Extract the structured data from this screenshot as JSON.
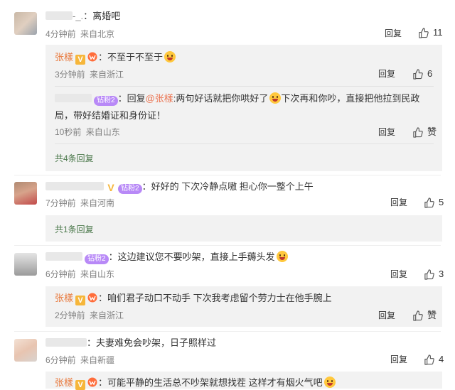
{
  "comments": [
    {
      "user": "-_.",
      "text": "离婚吧",
      "time": "4分钟前",
      "location": "来自北京",
      "reply_label": "回复",
      "likes": "11",
      "replies": [
        {
          "user": "张樣",
          "text": "不至于不至于",
          "time": "3分钟前",
          "location": "来自浙江",
          "reply_label": "回复",
          "likes": "6"
        },
        {
          "badge": "钻粉2",
          "prefix": "回复",
          "mention": "@张樣",
          "text": ":两句好话就把你哄好了",
          "text2": "下次再和你吵，直接把他拉到民政",
          "text3": "局，带好结婚证和身份证！",
          "time": "10秒前",
          "location": "来自山东",
          "reply_label": "回复",
          "likes": "赞"
        }
      ],
      "more": "共4条回复"
    },
    {
      "badge": "钻粉2",
      "text": "好好的 下次冷静点嗷 担心你一整个上午",
      "time": "7分钟前",
      "location": "来自河南",
      "reply_label": "回复",
      "likes": "5",
      "more": "共1条回复"
    },
    {
      "badge": "钻粉2",
      "text": "这边建议您不要吵架，直接上手薅头发",
      "time": "6分钟前",
      "location": "来自山东",
      "reply_label": "回复",
      "likes": "3",
      "replies": [
        {
          "user": "张樣",
          "text": "咱们君子动口不动手 下次我考虑留个劳力士在他手腕上",
          "time": "2分钟前",
          "location": "来自浙江",
          "reply_label": "回复",
          "likes": "赞"
        }
      ]
    },
    {
      "text": "夫妻难免会吵架，日子照样过",
      "time": "6分钟前",
      "location": "来自新疆",
      "reply_label": "回复",
      "likes": "4",
      "replies": [
        {
          "user": "张樣",
          "text": "可能平静的生活总不吵架就想找茬 这样才有烟火气吧"
        }
      ]
    }
  ],
  "colors": {
    "name": "#e8773a",
    "mention": "#eb7350",
    "more": "#4d7a4d",
    "reply_bg": "#f2f2f2",
    "diamond": "#b889f7",
    "v_badge": "#f6b63a"
  },
  "icons": [
    "thumb-up-icon",
    "v-badge-icon",
    "vip-badge-icon",
    "grin-emoji-icon"
  ]
}
